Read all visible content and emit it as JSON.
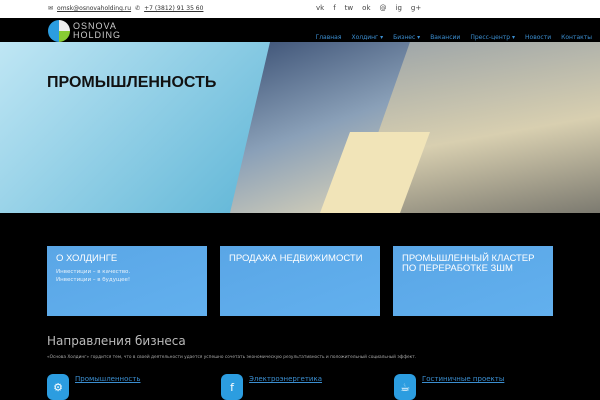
{
  "topbar": {
    "email": "omsk@osnovaholding.ru",
    "phone": "+7 (3812) 91 35 60",
    "social": [
      "vk",
      "f",
      "tw",
      "ok",
      "@",
      "ig",
      "g+"
    ]
  },
  "logo": {
    "line1": "OSNOVA",
    "line2": "HOLDING"
  },
  "nav": [
    "Главная",
    "Холдинг ▾",
    "Бизнес ▾",
    "Вакансии",
    "Пресс-центр ▾",
    "Новости",
    "Контакты"
  ],
  "hero": {
    "title": "ПРОМЫШЛЕННОСТЬ"
  },
  "boxes": [
    {
      "title": "О ХОЛДИНГЕ",
      "line1": "Инвестиции – в качество.",
      "line2": "Инвестиции – в будущее!"
    },
    {
      "title": "ПРОДАЖА НЕДВИЖИМОСТИ"
    },
    {
      "title": "ПРОМЫШЛЕННЫЙ КЛАСТЕР ПО ПЕРЕРАБОТКЕ ЗШМ"
    }
  ],
  "directions": {
    "title": "Направления бизнеса",
    "desc": "«Основа Холдинг» гордится тем, что в своей деятельности удается успешно сочетать экономическую результативность и положительный социальный эффект.",
    "items": [
      {
        "label": "Промышленность",
        "icon": "⚙"
      },
      {
        "label": "Электроэнергетика",
        "icon": "f"
      },
      {
        "label": "Гостиничные проекты",
        "icon": "☕"
      }
    ]
  }
}
